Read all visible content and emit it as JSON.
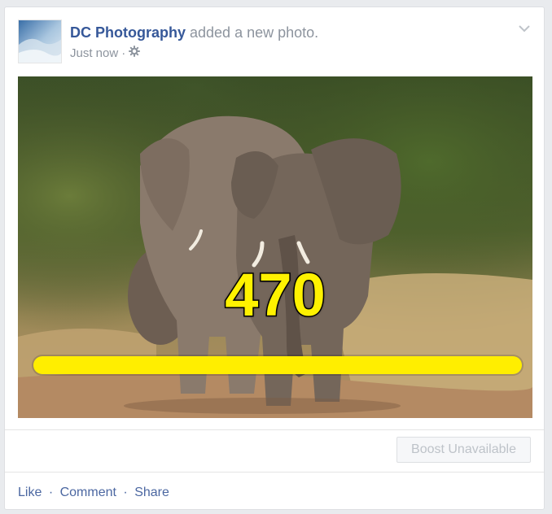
{
  "post": {
    "page_name": "DC Photography",
    "action_text": "added a new photo.",
    "time": "Just now",
    "separator": "·",
    "audience_icon": "gear-icon",
    "menu_icon": "chevron-down-icon"
  },
  "photo": {
    "subject": "elephant-family-photo",
    "overlay_count": "470",
    "overlay_color": "#fff200",
    "progress_fraction": 1.0
  },
  "boost": {
    "label": "Boost Unavailable"
  },
  "actions": {
    "like": "Like",
    "comment": "Comment",
    "share": "Share",
    "separator": "·"
  },
  "colors": {
    "link": "#365899",
    "muted": "#8d949e",
    "action_link": "#4b67a1"
  }
}
